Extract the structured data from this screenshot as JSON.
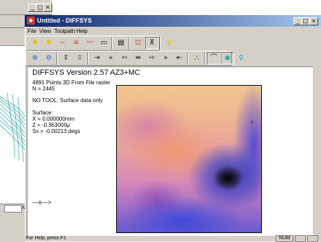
{
  "background_window": {
    "min_glyph": "_",
    "max_glyph": "□",
    "close_glyph": "×",
    "status_letter": "N"
  },
  "window": {
    "title": "Untitled - DIFFSYS",
    "min_glyph": "_",
    "max_glyph": "□",
    "close_glyph": "×"
  },
  "menu": [
    {
      "label": "File"
    },
    {
      "label": "View"
    },
    {
      "label": "Toolpath"
    },
    {
      "label": "Help"
    }
  ],
  "toolbar1": [
    {
      "icon": "sun-yellow-icon",
      "glyph": "✹",
      "color": "#e0c000"
    },
    {
      "icon": "sun-small-icon",
      "glyph": "✹",
      "color": "#e0c000"
    },
    {
      "icon": "wave-red-icon",
      "glyph": "∼",
      "color": "#d03030"
    },
    {
      "icon": "lines-red-icon",
      "glyph": "≡",
      "color": "#d03030"
    },
    {
      "icon": "wave-red-2-icon",
      "glyph": "〰",
      "color": "#d03030"
    },
    {
      "icon": "rectangle-icon",
      "glyph": "▭",
      "color": "#000000"
    },
    {
      "icon": "document-icon",
      "glyph": "▤",
      "color": "#000000"
    },
    {
      "icon": "machine-red-icon",
      "glyph": "⛫",
      "color": "#c02020"
    },
    {
      "icon": "tool-icon",
      "glyph": "⊼",
      "color": "#000000"
    },
    {
      "icon": "lightbulb-icon",
      "glyph": "♀",
      "color": "#e0c000"
    }
  ],
  "toolbar2": [
    {
      "icon": "zoom-in-icon",
      "glyph": "⊕",
      "color": "#1060c0"
    },
    {
      "icon": "zoom-out-icon",
      "glyph": "⊖",
      "color": "#1060c0"
    },
    {
      "icon": "pan-vertical-icon",
      "glyph": "⇕",
      "color": "#404040"
    },
    {
      "icon": "compress-vertical-icon",
      "glyph": "⇳",
      "color": "#404040"
    },
    {
      "icon": "step-right-icon",
      "glyph": "⇥",
      "color": "#202020"
    },
    {
      "icon": "rewind-icon",
      "glyph": "«",
      "color": "#202020"
    },
    {
      "icon": "arrow-left-icon",
      "glyph": "⇦",
      "color": "#202020"
    },
    {
      "icon": "bracket-arrows-icon",
      "glyph": "⇹",
      "color": "#202020"
    },
    {
      "icon": "arrow-right-icon",
      "glyph": "⇨",
      "color": "#202020"
    },
    {
      "icon": "fast-forward-icon",
      "glyph": "»",
      "color": "#202020"
    },
    {
      "icon": "step-left-icon",
      "glyph": "⇤",
      "color": "#202020"
    },
    {
      "icon": "3d-view-icon",
      "glyph": "⛬",
      "color": "#208020"
    },
    {
      "icon": "surface-view-icon",
      "glyph": "⌒",
      "color": "#202020"
    },
    {
      "icon": "map-view-icon",
      "glyph": "◉",
      "color": "#10a0a0"
    },
    {
      "icon": "help-bulb-icon",
      "glyph": "♀",
      "color": "#10b0c0"
    }
  ],
  "info": {
    "heading": "DIFFSYS Version 2.57 AZ3+MC",
    "line1": "4891 Points 3D From File raster",
    "line2": "N = 2445",
    "line3": "NO TOOL: Surface data only",
    "line4": "Surface:",
    "line5": "X = 0.000000mm",
    "line6": "Z = -0.363000μ",
    "line7": "Sx = -0.00213 degs"
  },
  "plot_marker": ">",
  "axis_arrow": "—x—>",
  "status": {
    "help_text": "For Help, press F1",
    "num": "NUM"
  }
}
